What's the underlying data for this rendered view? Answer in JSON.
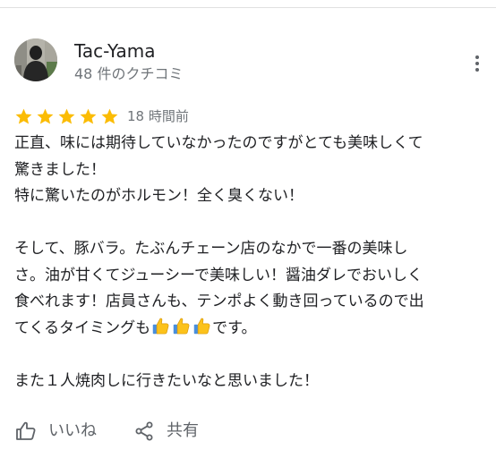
{
  "author": {
    "name": "Tac-Yama",
    "review_count": "48 件のクチコミ"
  },
  "icons": {
    "avatar": "avatar-photo",
    "more": "more-vert-icon",
    "star": "star-icon",
    "like": "thumb-up-outline-icon",
    "share": "share-icon",
    "emoji": "thumbs-up-emoji"
  },
  "rating": {
    "stars": 5,
    "max_stars": 5,
    "time_ago": "18 時間前",
    "star_color": "#fbbc04"
  },
  "review": {
    "paragraph1_line1": "正直、味には期待していなかったのですがとても美味しくて",
    "paragraph1_line2": "驚きました！",
    "paragraph1_line3": "特に驚いたのがホルモン！全く臭くない！",
    "paragraph2_line1": "そして、豚バラ。たぶんチェーン店のなかで一番の美味し",
    "paragraph2_line2": "さ。油が甘くてジューシーで美味しい！醤油ダレでおいしく",
    "paragraph2_line3": "食べれます！店員さんも、テンポよく動き回っているので出",
    "paragraph2_line4_before": "てくるタイミングも",
    "paragraph2_line4_after": "です。",
    "paragraph3_line1": "また１人焼肉しに行きたいなと思いました！"
  },
  "actions": {
    "like_label": "いいね",
    "share_label": "共有"
  }
}
